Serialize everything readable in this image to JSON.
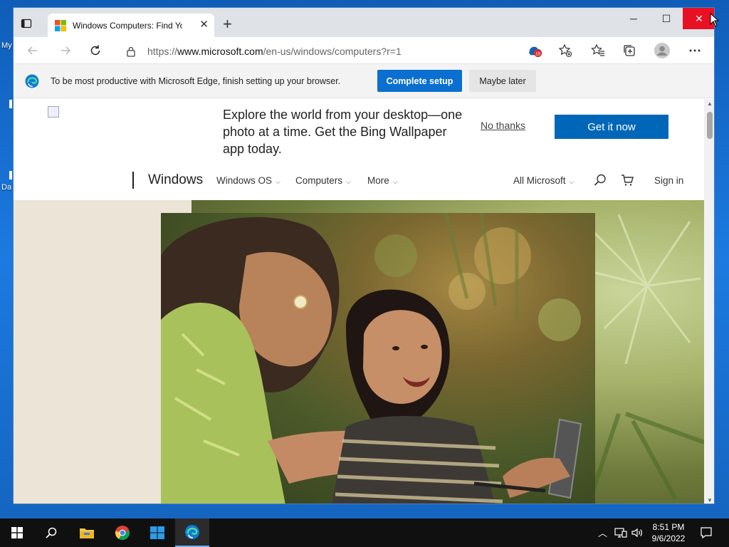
{
  "desktop": {
    "icon_labels": [
      "My",
      "Da"
    ]
  },
  "browser": {
    "tab": {
      "title": "Windows Computers: Find Your N"
    },
    "window_controls": {
      "minimize": "─",
      "maximize": "☐",
      "close": "✕"
    },
    "address_bar": {
      "scheme": "https://",
      "host": "www.microsoft.com",
      "path": "/en-us/windows/computers?r=1"
    },
    "toolbar": {
      "extension_badge": "15"
    },
    "infobar": {
      "message": "To be most productive with Microsoft Edge, finish setting up your browser.",
      "primary_button": "Complete setup",
      "secondary_button": "Maybe later"
    }
  },
  "page": {
    "promo": {
      "text": "Explore the world from your desktop—one photo at a time. Get the Bing Wallpaper app today.",
      "dismiss": "No thanks",
      "cta": "Get it now"
    },
    "nav": {
      "brand": "Windows",
      "items": [
        "Windows OS",
        "Computers",
        "More"
      ],
      "all_microsoft": "All Microsoft",
      "sign_in": "Sign in"
    }
  },
  "taskbar": {
    "clock_time": "8:51 PM",
    "clock_date": "9/6/2022"
  },
  "colors": {
    "accent": "#0067b8",
    "edge_blue": "#0b6fd0",
    "close_red": "#e81123",
    "taskbar": "#101010"
  }
}
